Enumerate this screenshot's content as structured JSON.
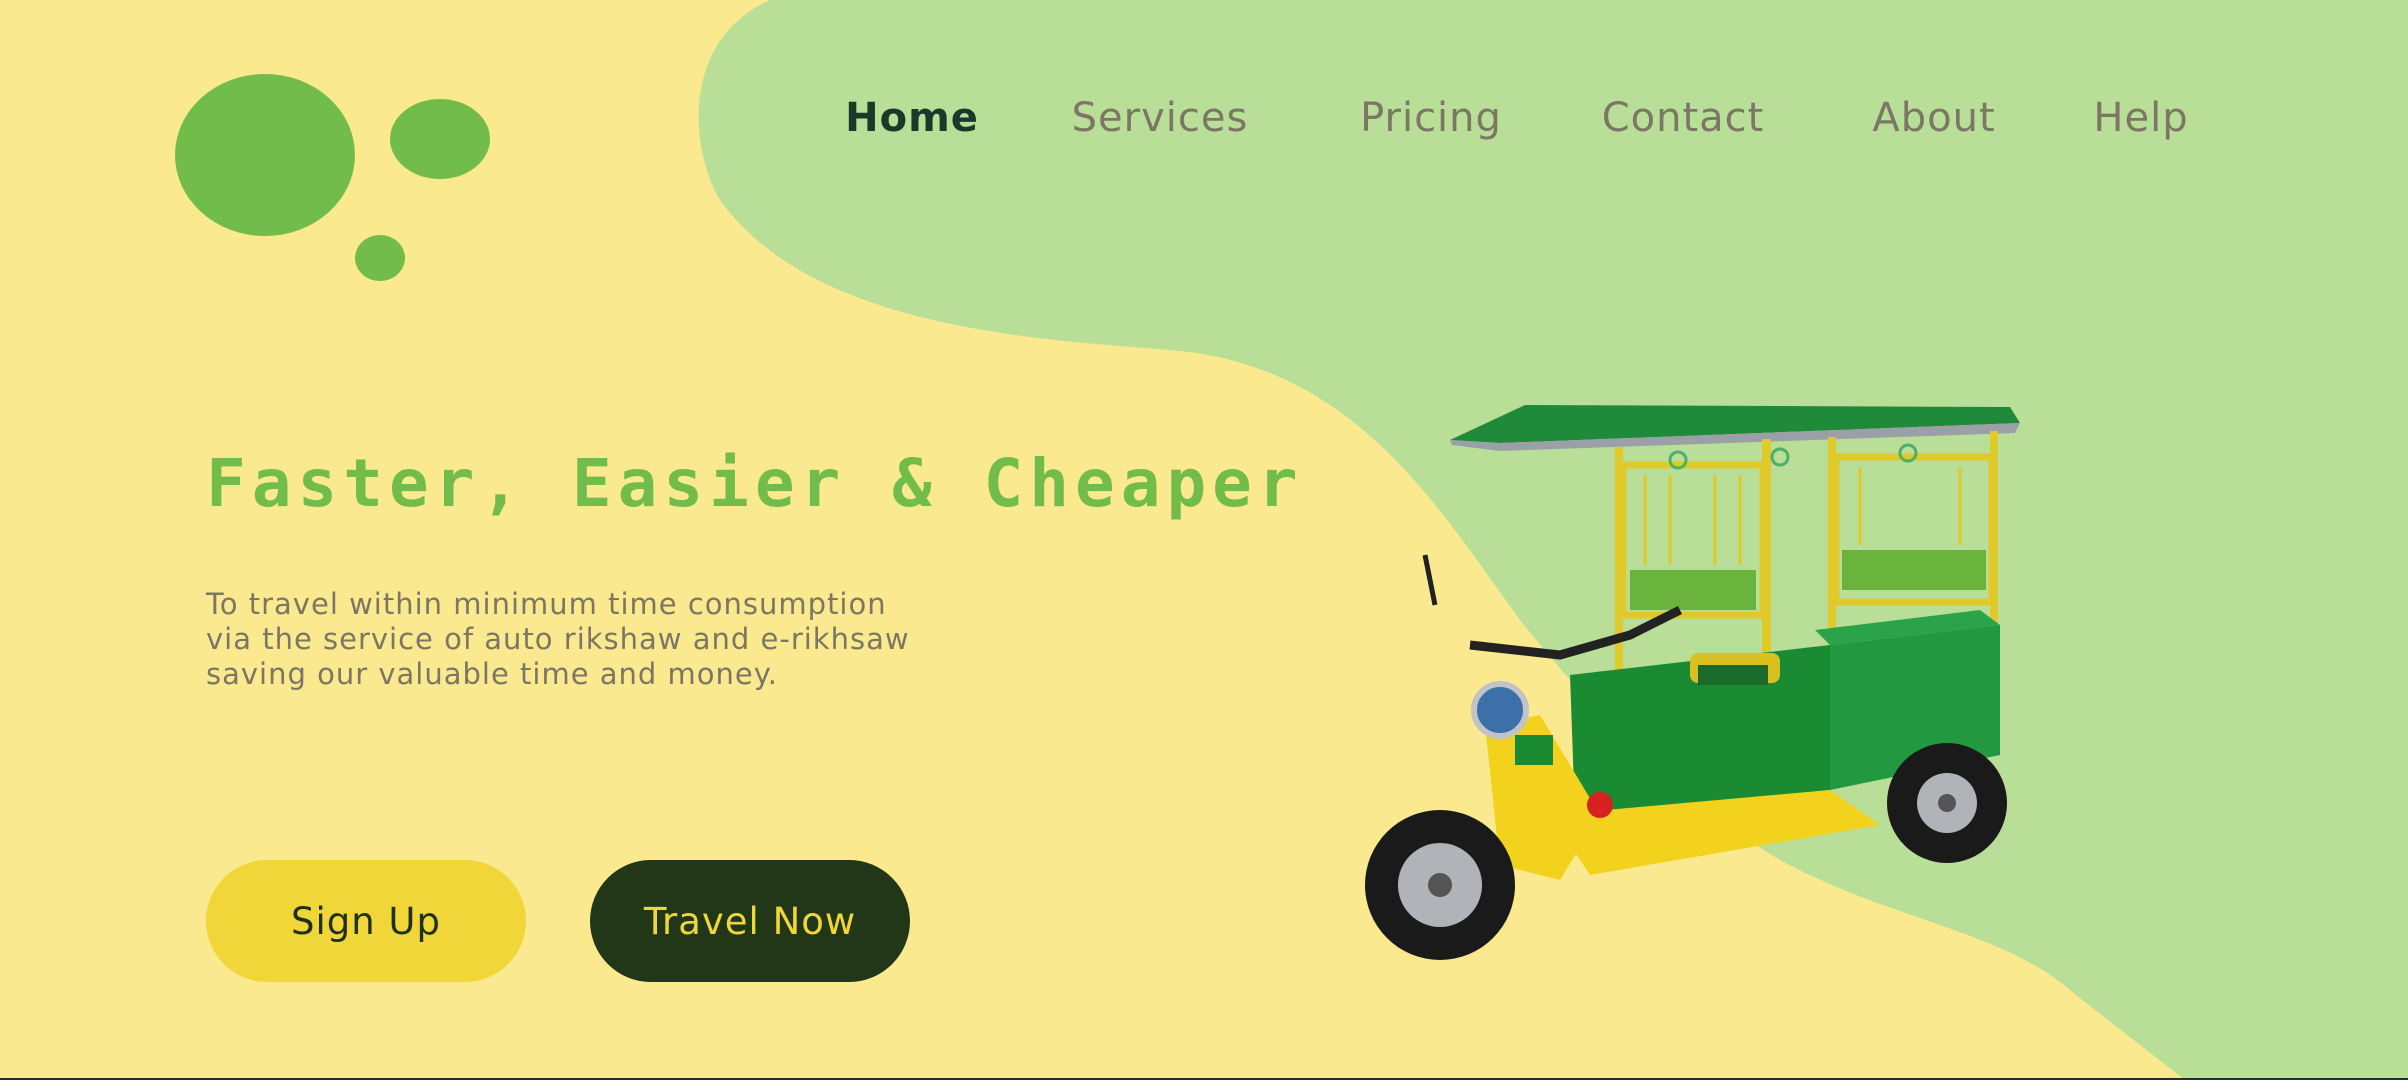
{
  "brand": {
    "logo_icon": "three-green-circles-logo",
    "colors": {
      "background": "#fbe98f",
      "wave": "#b8de98",
      "accent_green": "#72bc4b",
      "button_yellow": "#f1d63a",
      "button_dark": "#213717"
    }
  },
  "nav": {
    "items": [
      {
        "label": "Home",
        "active": true
      },
      {
        "label": "Services",
        "active": false
      },
      {
        "label": "Pricing",
        "active": false
      },
      {
        "label": "Contact",
        "active": false
      },
      {
        "label": "About",
        "active": false
      },
      {
        "label": "Help",
        "active": false
      }
    ]
  },
  "hero": {
    "headline": "Faster, Easier & Cheaper",
    "description_lines": [
      "To travel within minimum time consumption",
      "via the service of auto rikshaw and e-rikhsaw",
      "saving our valuable time and money."
    ],
    "signup_label": "Sign Up",
    "travel_label": "Travel Now",
    "image_icon": "e-rickshaw-illustration"
  }
}
